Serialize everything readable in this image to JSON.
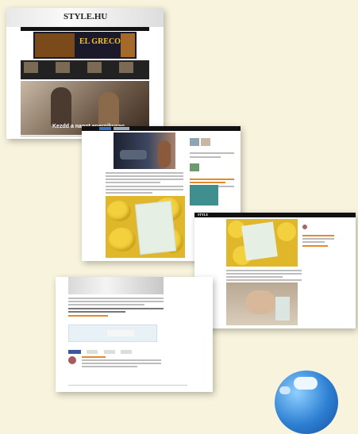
{
  "screenshots": [
    {
      "id": "homepage",
      "logo": "STYLE.HU",
      "ad_title": "EL GRECO",
      "hero_caption": "Kezdd a napot energikusan"
    },
    {
      "id": "article-top"
    },
    {
      "id": "article-middle",
      "logo": "STYLE"
    },
    {
      "id": "article-bottom"
    }
  ],
  "colors": {
    "background": "#f8f3dc",
    "accent_orange": "#e38a2a",
    "facebook_blue": "#3b5998",
    "ad_gold": "#f3c23a"
  },
  "decorations": {
    "globe": "globe-icon"
  }
}
